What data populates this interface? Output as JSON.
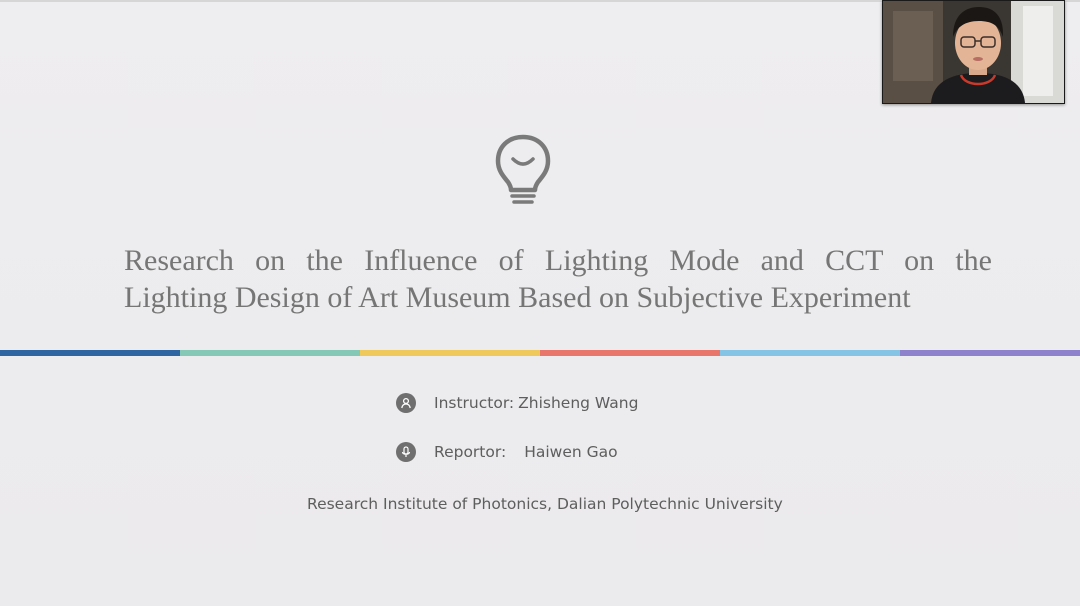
{
  "slide": {
    "title_line1": "Research on the Influence of Lighting Mode and CCT on the",
    "title_line2": "Lighting Design of Art Museum Based on Subjective Experiment",
    "instructor_label": "Instructor:",
    "instructor_name": "Zhisheng Wang",
    "reportor_label": "Reportor:",
    "reportor_name": "Haiwen Gao",
    "affiliation": "Research Institute of Photonics, Dalian Polytechnic University",
    "icons": {
      "header": "lightbulb-icon",
      "instructor": "person-icon",
      "reportor": "microphone-icon"
    },
    "color_bar": [
      "#2f65a0",
      "#86c8b6",
      "#f0c95c",
      "#e8766a",
      "#86c4e6",
      "#8f82cc"
    ]
  },
  "video_call": {
    "participant_icon": "webcam-participant"
  }
}
